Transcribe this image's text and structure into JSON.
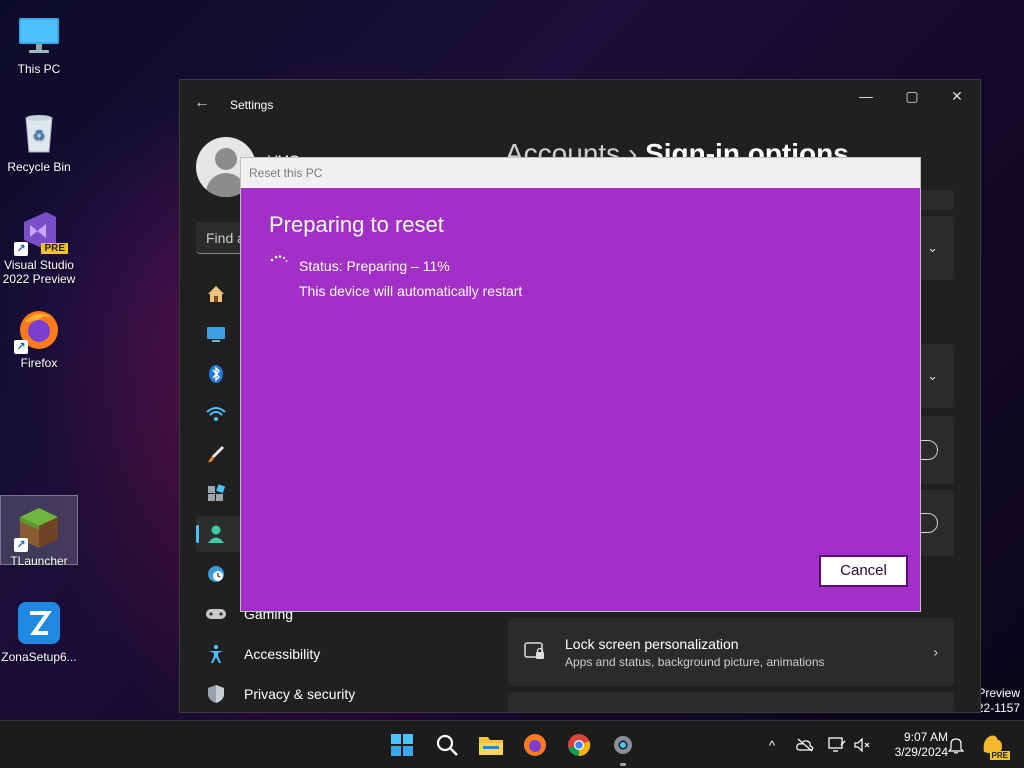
{
  "desktop": {
    "icons": [
      {
        "label": "This PC"
      },
      {
        "label": "Recycle Bin"
      },
      {
        "label": "Visual Studio 2022 Preview"
      },
      {
        "label": "Firefox"
      },
      {
        "label": "TLauncher"
      },
      {
        "label": "ZonaSetup6..."
      }
    ],
    "vs_badge": "PRE"
  },
  "settings_window": {
    "title": "Settings",
    "back_glyph": "←",
    "minimize_glyph": "—",
    "maximize_glyph": "▢",
    "close_glyph": "✕",
    "user_name": "VMG",
    "find_placeholder": "Find a",
    "breadcrumb": {
      "parent": "Accounts",
      "separator": "›",
      "current": "Sign-in options"
    },
    "nav": [
      {
        "label": "",
        "icon": "home-icon"
      },
      {
        "label": "",
        "icon": "system-icon"
      },
      {
        "label": "",
        "icon": "bluetooth-icon"
      },
      {
        "label": "",
        "icon": "wifi-icon"
      },
      {
        "label": "",
        "icon": "brush-icon"
      },
      {
        "label": "",
        "icon": "apps-icon"
      },
      {
        "label": "",
        "icon": "accounts-icon"
      },
      {
        "label": "",
        "icon": "time-language-icon"
      },
      {
        "label": "Gaming",
        "icon": "gamepad-icon"
      },
      {
        "label": "Accessibility",
        "icon": "accessibility-icon"
      },
      {
        "label": "Privacy & security",
        "icon": "shield-icon"
      }
    ],
    "chevron_down_glyph": "⌄",
    "chevron_right_glyph": "›",
    "lock_screen": {
      "title": "Lock screen personalization",
      "subtitle": "Apps and status, background picture, animations"
    }
  },
  "reset_dialog": {
    "title": "Reset this PC",
    "heading": "Preparing to reset",
    "status": "Status: Preparing – 11%",
    "progress_percent": 11,
    "message": "This device will automatically restart",
    "cancel_label": "Cancel",
    "background_color": "#a12fc8"
  },
  "watermark": {
    "line1": "Preview",
    "line2": "22-1157"
  },
  "taskbar": {
    "icons": [
      "start-icon",
      "search-icon",
      "file-explorer-icon",
      "firefox-icon",
      "chrome-icon",
      "settings-icon"
    ],
    "tray_chevron": "^",
    "time": "9:07 AM",
    "date": "3/29/2024",
    "pre_badge": "PRE"
  }
}
